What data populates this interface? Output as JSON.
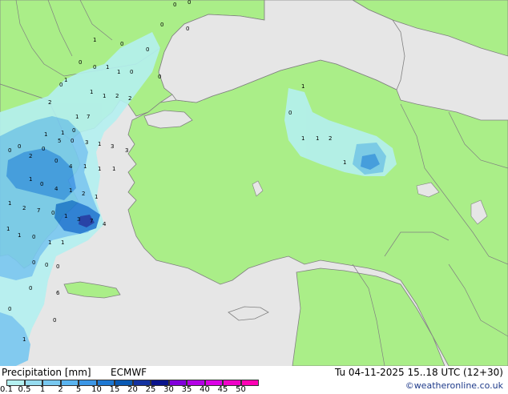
{
  "legend": {
    "title": "Precipitation [mm]",
    "model": "ECMWF",
    "valid_time": "Tu 04-11-2025 15..18 UTC (12+30)",
    "credit": "©weatheronline.co.uk",
    "ticks": [
      "0.1",
      "0.5",
      "1",
      "2",
      "5",
      "10",
      "15",
      "20",
      "25",
      "30",
      "35",
      "40",
      "45",
      "50"
    ],
    "colors": [
      "#b4f0f0",
      "#96dcf0",
      "#78c8f0",
      "#5ab4f0",
      "#3c96e6",
      "#1e78d2",
      "#0a5ab4",
      "#1432a0",
      "#0a148c",
      "#8200dc",
      "#b400e6",
      "#dc00e6",
      "#f000c8",
      "#ff00b4"
    ]
  },
  "map_colors": {
    "sea": "#e6e6e6",
    "land": "#aaee88",
    "border": "#808080"
  },
  "values": [
    "0",
    "0",
    "1",
    "0",
    "0",
    "0",
    "0",
    "0",
    "0",
    "0",
    "1",
    "1",
    "0",
    "1",
    "0",
    "1",
    "1",
    "2",
    "2",
    "2",
    "7",
    "1",
    "0",
    "1",
    "1",
    "5",
    "0",
    "0",
    "3",
    "1",
    "3",
    "3",
    "0",
    "0",
    "2",
    "0",
    "4",
    "1",
    "1",
    "1",
    "1",
    "0",
    "4",
    "1",
    "2",
    "1",
    "1",
    "2",
    "7",
    "0",
    "1",
    "3",
    "7",
    "4",
    "1",
    "1",
    "0",
    "1",
    "1",
    "0",
    "0",
    "0",
    "0",
    "6",
    "0",
    "0",
    "1",
    "1",
    "0",
    "1",
    "1",
    "2",
    "1"
  ]
}
